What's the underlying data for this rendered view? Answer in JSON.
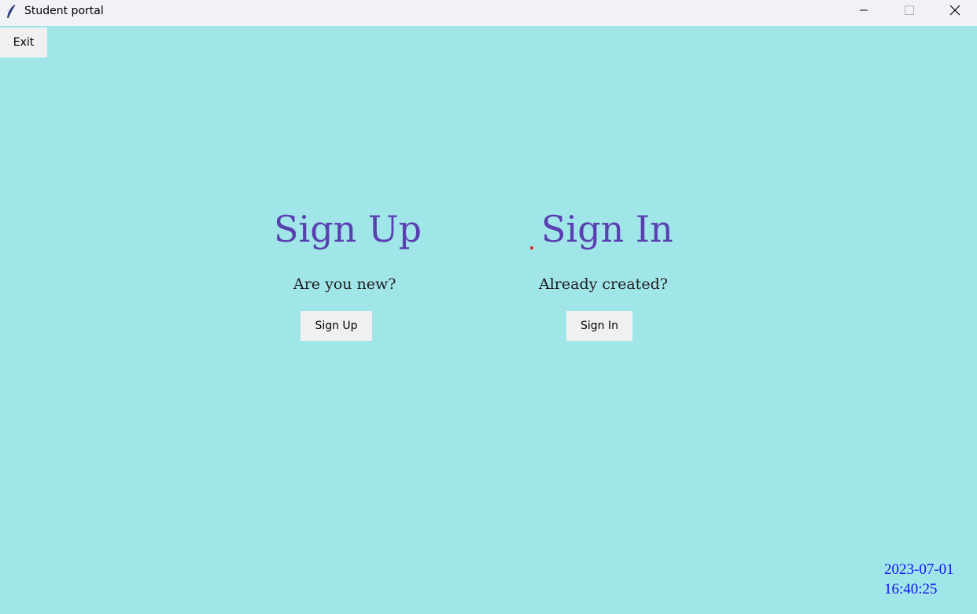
{
  "window": {
    "title": "Student portal",
    "icon": "feather-icon"
  },
  "toolbar": {
    "exit_label": "Exit"
  },
  "signup": {
    "heading": "Sign Up",
    "subtitle": "Are you new?",
    "button_label": "Sign Up"
  },
  "signin": {
    "heading": "Sign In",
    "subtitle": "Already created?",
    "button_label": "Sign In"
  },
  "clock": {
    "date": "2023-07-01",
    "time": "16:40:25"
  },
  "colors": {
    "background": "#a0e6e9",
    "heading": "#5a3fb0",
    "clock": "#1010ff"
  }
}
